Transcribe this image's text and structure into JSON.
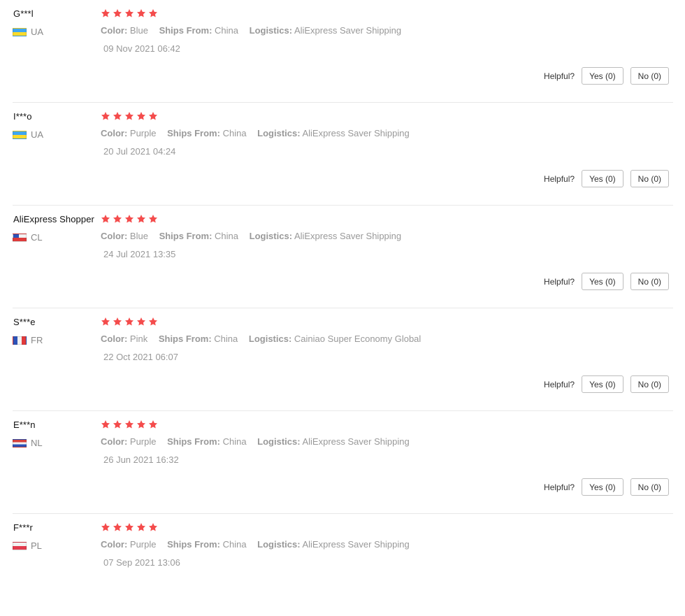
{
  "colors": {
    "star": "#f44c4c",
    "muted_text": "#999999",
    "divider": "#e8e8e8"
  },
  "labels": {
    "color": "Color:",
    "ships_from": "Ships From:",
    "logistics": "Logistics:",
    "helpful": "Helpful?"
  },
  "reviews": [
    {
      "user": "G***l",
      "country": "UA",
      "rating": 5,
      "color": "Blue",
      "ships_from": "China",
      "logistics": "AliExpress Saver Shipping",
      "date": "09 Nov 2021 06:42",
      "yes": "Yes (0)",
      "no": "No (0)"
    },
    {
      "user": "I***o",
      "country": "UA",
      "rating": 5,
      "color": "Purple",
      "ships_from": "China",
      "logistics": "AliExpress Saver Shipping",
      "date": "20 Jul 2021 04:24",
      "yes": "Yes (0)",
      "no": "No (0)"
    },
    {
      "user": "AliExpress Shopper",
      "country": "CL",
      "rating": 5,
      "color": "Blue",
      "ships_from": "China",
      "logistics": "AliExpress Saver Shipping",
      "date": "24 Jul 2021 13:35",
      "yes": "Yes (0)",
      "no": "No (0)"
    },
    {
      "user": "S***e",
      "country": "FR",
      "rating": 5,
      "color": "Pink",
      "ships_from": "China",
      "logistics": "Cainiao Super Economy Global",
      "date": "22 Oct 2021 06:07",
      "yes": "Yes (0)",
      "no": "No (0)"
    },
    {
      "user": "E***n",
      "country": "NL",
      "rating": 5,
      "color": "Purple",
      "ships_from": "China",
      "logistics": "AliExpress Saver Shipping",
      "date": "26 Jun 2021 16:32",
      "yes": "Yes (0)",
      "no": "No (0)"
    },
    {
      "user": "F***r",
      "country": "PL",
      "rating": 5,
      "color": "Purple",
      "ships_from": "China",
      "logistics": "AliExpress Saver Shipping",
      "date": "07 Sep 2021 13:06"
    }
  ]
}
